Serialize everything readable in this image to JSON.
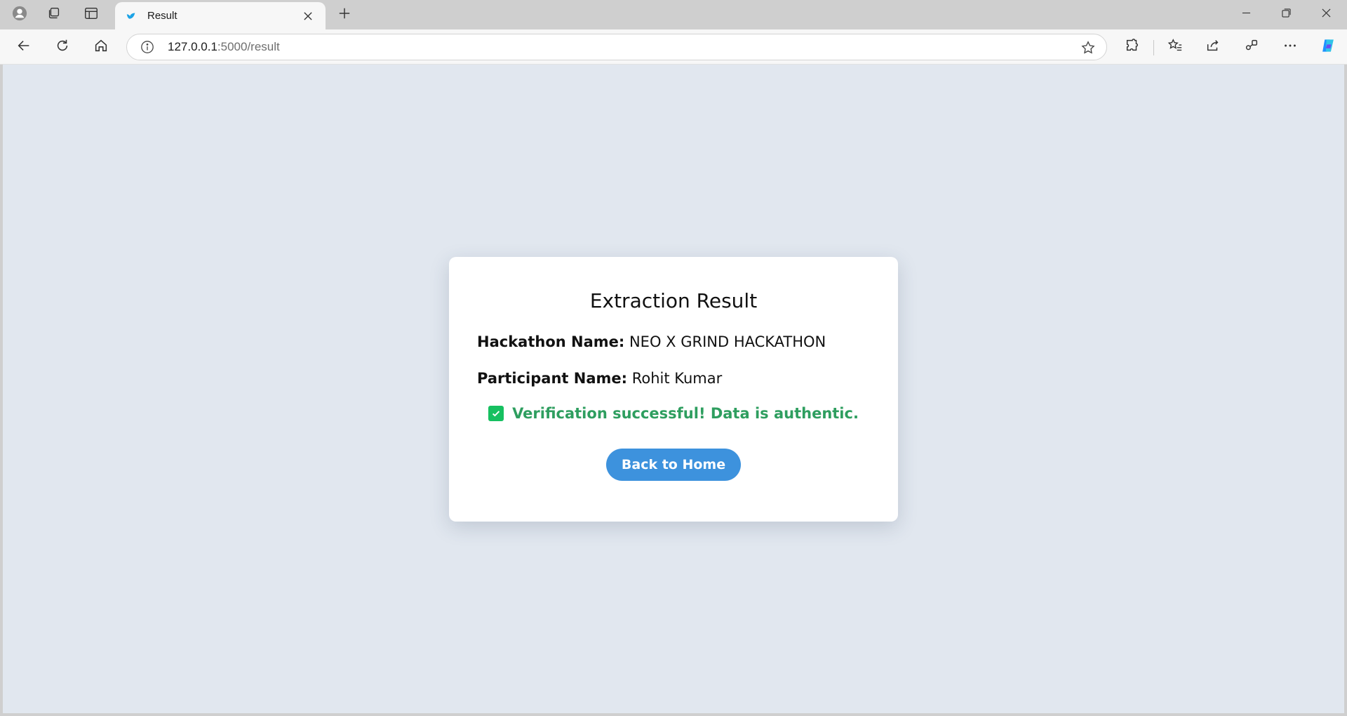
{
  "browser": {
    "tab": {
      "title": "Result"
    },
    "address": {
      "host": "127.0.0.1",
      "rest": ":5000/result"
    }
  },
  "page": {
    "title": "Extraction Result",
    "hackathon": {
      "label": "Hackathon Name:",
      "value": "NEO X GRIND HACKATHON"
    },
    "participant": {
      "label": "Participant Name:",
      "value": "Rohit Kumar"
    },
    "verification": {
      "message": "Verification successful! Data is authentic.",
      "color": "#2e9e5f"
    },
    "button": {
      "label": "Back to Home",
      "color": "#3d92dd"
    }
  }
}
